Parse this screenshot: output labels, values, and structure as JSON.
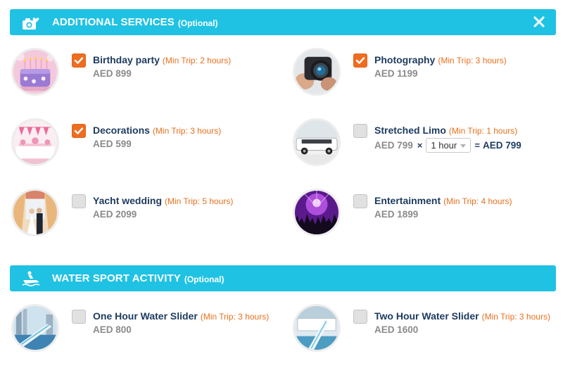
{
  "additional": {
    "title": "ADDITIONAL SERVICES",
    "subtitle": "(Optional)",
    "icon": "camera-heart-icon",
    "close_icon": "close-icon",
    "items": [
      {
        "name": "Birthday party",
        "min": "(Min Trip: 2 hours)",
        "price": "AED 899",
        "checked": true,
        "image": "birthday-cake"
      },
      {
        "name": "Photography",
        "min": "(Min Trip: 3 hours)",
        "price": "AED 1199",
        "checked": true,
        "image": "camera-lens"
      },
      {
        "name": "Decorations",
        "min": "(Min Trip: 3 hours)",
        "price": "AED 599",
        "checked": true,
        "image": "pink-decor"
      },
      {
        "name": "Stretched Limo",
        "min": "(Min Trip: 1 hours)",
        "price": "AED 799",
        "checked": false,
        "image": "white-limo",
        "times": "×",
        "duration": "1 hour",
        "equals": "=",
        "total": "AED 799"
      },
      {
        "name": "Yacht wedding",
        "min": "(Min Trip: 5 hours)",
        "price": "AED 2099",
        "checked": false,
        "image": "wedding-couple"
      },
      {
        "name": "Entertainment",
        "min": "(Min Trip: 4 hours)",
        "price": "AED 1899",
        "checked": false,
        "image": "concert-crowd"
      }
    ]
  },
  "water": {
    "title": "WATER SPORT ACTIVITY",
    "subtitle": "(Optional)",
    "icon": "jet-ski-icon",
    "items": [
      {
        "name": "One Hour Water Slider",
        "min": "(Min Trip: 3 hours)",
        "price": "AED 800",
        "checked": false,
        "image": "water-slide-city"
      },
      {
        "name": "Two Hour Water Slider",
        "min": "(Min Trip: 3 hours)",
        "price": "AED 1600",
        "checked": false,
        "image": "water-slide-yacht"
      }
    ]
  },
  "colors": {
    "header": "#1fc2e3",
    "checkbox_on": "#ef6d20",
    "name": "#1d3a5f",
    "min_trip": "#e8701e",
    "price": "#8a8a8a"
  }
}
